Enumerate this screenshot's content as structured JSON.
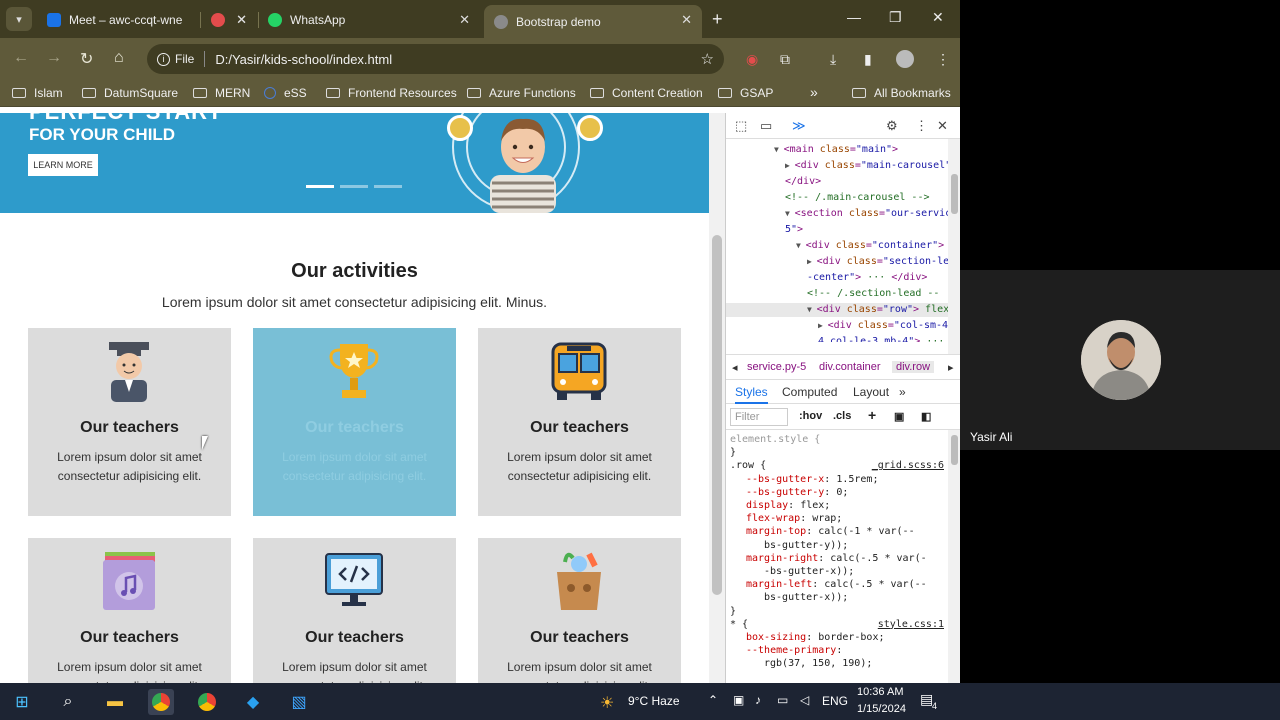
{
  "browser": {
    "tabs": [
      {
        "title": "Meet – awc-ccqt-wne",
        "color": "#1a73e8"
      },
      {
        "title": "",
        "color": "#e34c4c"
      },
      {
        "title": "WhatsApp",
        "color": "#25d366"
      },
      {
        "title": "Bootstrap demo",
        "color": "#8a8a8a",
        "active": true
      }
    ],
    "address": {
      "scheme_label": "File",
      "url": "D:/Yasir/kids-school/index.html"
    },
    "bookmarks": [
      "Islam",
      "DatumSquare",
      "MERN",
      "eSS",
      "Frontend Resources",
      "Azure Functions",
      "Content Creation",
      "GSAP"
    ],
    "bookmarks_overflow": "»",
    "all_bookmarks": "All Bookmarks"
  },
  "page": {
    "hero": {
      "heading_cut": "PERFECT START",
      "subheading": "FOR YOUR CHILD",
      "button": "LEARN MORE",
      "slides": 3,
      "active_slide": 1
    },
    "section": {
      "title": "Our activities",
      "lead": "Lorem ipsum dolor sit amet consectetur adipisicing elit. Minus."
    },
    "cards": [
      {
        "title": "Our teachers",
        "text": "Lorem ipsum dolor sit amet consectetur adipisicing elit.",
        "icon": "teacher-icon",
        "highlight": false
      },
      {
        "title": "Our teachers",
        "text": "Lorem ipsum dolor sit amet consectetur adipisicing elit.",
        "icon": "trophy-icon",
        "highlight": true
      },
      {
        "title": "Our teachers",
        "text": "Lorem ipsum dolor sit amet consectetur adipisicing elit.",
        "icon": "school-bus-icon",
        "highlight": false
      },
      {
        "title": "Our teachers",
        "text": "Lorem ipsum dolor sit amet consectetur adipisicing elit.",
        "icon": "music-book-icon",
        "highlight": false
      },
      {
        "title": "Our teachers",
        "text": "Lorem ipsum dolor sit amet consectetur adipisicing elit.",
        "icon": "code-monitor-icon",
        "highlight": false
      },
      {
        "title": "Our teachers",
        "text": "Lorem ipsum dolor sit amet consectetur adipisicing elit.",
        "icon": "grocery-bag-icon",
        "highlight": false
      }
    ]
  },
  "devtools": {
    "dom_lines": [
      {
        "indent": 0,
        "arrow": "▼",
        "parts": [
          [
            "t",
            "<main "
          ],
          [
            "a",
            "class"
          ],
          [
            "t",
            "="
          ],
          [
            "v",
            "\"main\""
          ],
          [
            "t",
            ">"
          ]
        ]
      },
      {
        "indent": 1,
        "arrow": "▶",
        "parts": [
          [
            "t",
            "<div "
          ],
          [
            "a",
            "class"
          ],
          [
            "t",
            "="
          ],
          [
            "v",
            "\"main-carousel\""
          ]
        ]
      },
      {
        "indent": 1,
        "arrow": "",
        "parts": [
          [
            "t",
            "</div>"
          ]
        ]
      },
      {
        "indent": 1,
        "arrow": "",
        "parts": [
          [
            "c",
            "<!-- /.main-carousel -->"
          ]
        ]
      },
      {
        "indent": 1,
        "arrow": "▼",
        "parts": [
          [
            "t",
            "<section "
          ],
          [
            "a",
            "class"
          ],
          [
            "t",
            "="
          ],
          [
            "v",
            "\"our-servic"
          ]
        ]
      },
      {
        "indent": 1,
        "arrow": "",
        "parts": [
          [
            "v",
            "5\""
          ],
          [
            "t",
            ">"
          ]
        ]
      },
      {
        "indent": 2,
        "arrow": "▼",
        "parts": [
          [
            "t",
            "<div "
          ],
          [
            "a",
            "class"
          ],
          [
            "t",
            "="
          ],
          [
            "v",
            "\"container\""
          ],
          [
            "t",
            ">"
          ]
        ]
      },
      {
        "indent": 3,
        "arrow": "▶",
        "parts": [
          [
            "t",
            "<div "
          ],
          [
            "a",
            "class"
          ],
          [
            "t",
            "="
          ],
          [
            "v",
            "\"section-le"
          ]
        ]
      },
      {
        "indent": 3,
        "arrow": "",
        "parts": [
          [
            "v",
            "-center\""
          ],
          [
            "t",
            ">"
          ],
          [
            "c",
            " ··· "
          ],
          [
            "t",
            "</div>"
          ]
        ]
      },
      {
        "indent": 3,
        "arrow": "",
        "parts": [
          [
            "c",
            "<!-- /.section-lead --"
          ]
        ]
      },
      {
        "indent": 3,
        "arrow": "▼",
        "parts": [
          [
            "t",
            "<div "
          ],
          [
            "a",
            "class"
          ],
          [
            "t",
            "="
          ],
          [
            "v",
            "\"row\""
          ],
          [
            "t",
            ">"
          ],
          [
            "c",
            " flex"
          ]
        ],
        "selected": true
      },
      {
        "indent": 4,
        "arrow": "▶",
        "parts": [
          [
            "t",
            "<div "
          ],
          [
            "a",
            "class"
          ],
          [
            "t",
            "="
          ],
          [
            "v",
            "\"col-sm-4"
          ]
        ]
      },
      {
        "indent": 4,
        "arrow": "",
        "parts": [
          [
            "v",
            "4 col-le-3 mb-4\""
          ],
          [
            "t",
            ">"
          ],
          [
            "c",
            " ···"
          ]
        ]
      }
    ],
    "crumbs": [
      "service.py-5",
      "div.container",
      "div.row"
    ],
    "style_tabs": [
      "Styles",
      "Computed",
      "Layout",
      "»"
    ],
    "filter_placeholder": "Filter",
    "filter_opts": [
      ":hov",
      ".cls",
      "+"
    ],
    "css_lines": [
      {
        "type": "sel",
        "text": "element.style {"
      },
      {
        "type": "sel",
        "text": "}"
      },
      {
        "type": "rule",
        "text": ".row {",
        "src": "_grid.scss:6"
      },
      {
        "type": "prop",
        "name": "--bs-gutter-x",
        "value": "1.5rem;"
      },
      {
        "type": "prop",
        "name": "--bs-gutter-y",
        "value": "0;"
      },
      {
        "type": "prop",
        "name": "display",
        "value": "flex;"
      },
      {
        "type": "prop",
        "name": "flex-wrap",
        "value": "wrap;"
      },
      {
        "type": "prop",
        "name": "margin-top",
        "value": "calc(-1 * var(--"
      },
      {
        "type": "cont",
        "value": "bs-gutter-y));"
      },
      {
        "type": "prop",
        "name": "margin-right",
        "value": "calc(-.5 * var(-"
      },
      {
        "type": "cont",
        "value": "-bs-gutter-x));"
      },
      {
        "type": "prop",
        "name": "margin-left",
        "value": "calc(-.5 * var(--"
      },
      {
        "type": "cont",
        "value": "bs-gutter-x));"
      },
      {
        "type": "sel",
        "text": "}"
      },
      {
        "type": "rule",
        "text": "* {",
        "src": "style.css:1"
      },
      {
        "type": "prop",
        "name": "box-sizing",
        "value": "border-box;"
      },
      {
        "type": "prop",
        "name": "--theme-primary",
        "value": ""
      },
      {
        "type": "cont",
        "value": "rgb(37, 150, 190);"
      }
    ]
  },
  "meeting": {
    "participant": "Yasir Ali"
  },
  "taskbar": {
    "weather": "9°C Haze",
    "lang": "ENG",
    "time": "10:36 AM",
    "date": "1/15/2024",
    "notifications": "4"
  },
  "colors": {
    "hero": "#2e9bcb",
    "card": "#dcdcdc",
    "card_highlight": "#79bfd6",
    "chrome": "#5f5a3a"
  }
}
